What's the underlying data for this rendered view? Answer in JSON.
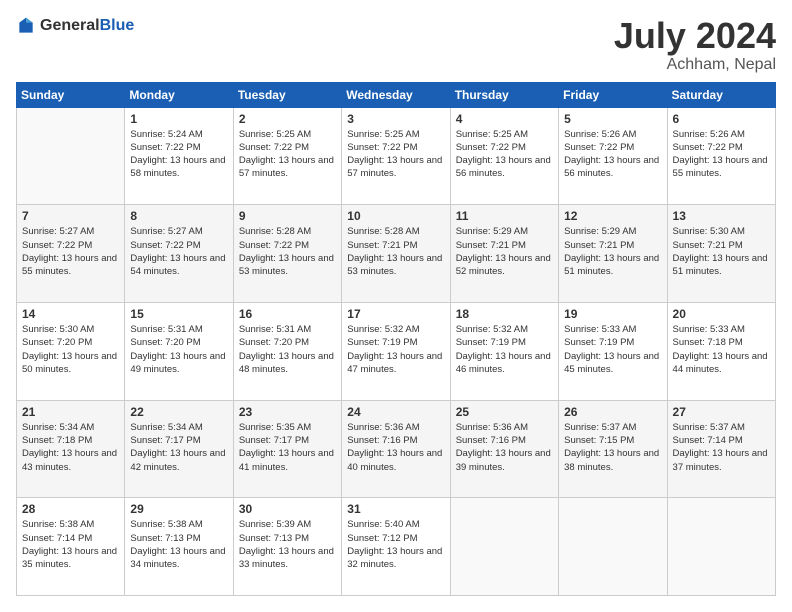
{
  "logo": {
    "general": "General",
    "blue": "Blue"
  },
  "title": {
    "month_year": "July 2024",
    "location": "Achham, Nepal"
  },
  "headers": [
    "Sunday",
    "Monday",
    "Tuesday",
    "Wednesday",
    "Thursday",
    "Friday",
    "Saturday"
  ],
  "weeks": [
    [
      {
        "day": "",
        "sunrise": "",
        "sunset": "",
        "daylight": ""
      },
      {
        "day": "1",
        "sunrise": "Sunrise: 5:24 AM",
        "sunset": "Sunset: 7:22 PM",
        "daylight": "Daylight: 13 hours and 58 minutes."
      },
      {
        "day": "2",
        "sunrise": "Sunrise: 5:25 AM",
        "sunset": "Sunset: 7:22 PM",
        "daylight": "Daylight: 13 hours and 57 minutes."
      },
      {
        "day": "3",
        "sunrise": "Sunrise: 5:25 AM",
        "sunset": "Sunset: 7:22 PM",
        "daylight": "Daylight: 13 hours and 57 minutes."
      },
      {
        "day": "4",
        "sunrise": "Sunrise: 5:25 AM",
        "sunset": "Sunset: 7:22 PM",
        "daylight": "Daylight: 13 hours and 56 minutes."
      },
      {
        "day": "5",
        "sunrise": "Sunrise: 5:26 AM",
        "sunset": "Sunset: 7:22 PM",
        "daylight": "Daylight: 13 hours and 56 minutes."
      },
      {
        "day": "6",
        "sunrise": "Sunrise: 5:26 AM",
        "sunset": "Sunset: 7:22 PM",
        "daylight": "Daylight: 13 hours and 55 minutes."
      }
    ],
    [
      {
        "day": "7",
        "sunrise": "Sunrise: 5:27 AM",
        "sunset": "Sunset: 7:22 PM",
        "daylight": "Daylight: 13 hours and 55 minutes."
      },
      {
        "day": "8",
        "sunrise": "Sunrise: 5:27 AM",
        "sunset": "Sunset: 7:22 PM",
        "daylight": "Daylight: 13 hours and 54 minutes."
      },
      {
        "day": "9",
        "sunrise": "Sunrise: 5:28 AM",
        "sunset": "Sunset: 7:22 PM",
        "daylight": "Daylight: 13 hours and 53 minutes."
      },
      {
        "day": "10",
        "sunrise": "Sunrise: 5:28 AM",
        "sunset": "Sunset: 7:21 PM",
        "daylight": "Daylight: 13 hours and 53 minutes."
      },
      {
        "day": "11",
        "sunrise": "Sunrise: 5:29 AM",
        "sunset": "Sunset: 7:21 PM",
        "daylight": "Daylight: 13 hours and 52 minutes."
      },
      {
        "day": "12",
        "sunrise": "Sunrise: 5:29 AM",
        "sunset": "Sunset: 7:21 PM",
        "daylight": "Daylight: 13 hours and 51 minutes."
      },
      {
        "day": "13",
        "sunrise": "Sunrise: 5:30 AM",
        "sunset": "Sunset: 7:21 PM",
        "daylight": "Daylight: 13 hours and 51 minutes."
      }
    ],
    [
      {
        "day": "14",
        "sunrise": "Sunrise: 5:30 AM",
        "sunset": "Sunset: 7:20 PM",
        "daylight": "Daylight: 13 hours and 50 minutes."
      },
      {
        "day": "15",
        "sunrise": "Sunrise: 5:31 AM",
        "sunset": "Sunset: 7:20 PM",
        "daylight": "Daylight: 13 hours and 49 minutes."
      },
      {
        "day": "16",
        "sunrise": "Sunrise: 5:31 AM",
        "sunset": "Sunset: 7:20 PM",
        "daylight": "Daylight: 13 hours and 48 minutes."
      },
      {
        "day": "17",
        "sunrise": "Sunrise: 5:32 AM",
        "sunset": "Sunset: 7:19 PM",
        "daylight": "Daylight: 13 hours and 47 minutes."
      },
      {
        "day": "18",
        "sunrise": "Sunrise: 5:32 AM",
        "sunset": "Sunset: 7:19 PM",
        "daylight": "Daylight: 13 hours and 46 minutes."
      },
      {
        "day": "19",
        "sunrise": "Sunrise: 5:33 AM",
        "sunset": "Sunset: 7:19 PM",
        "daylight": "Daylight: 13 hours and 45 minutes."
      },
      {
        "day": "20",
        "sunrise": "Sunrise: 5:33 AM",
        "sunset": "Sunset: 7:18 PM",
        "daylight": "Daylight: 13 hours and 44 minutes."
      }
    ],
    [
      {
        "day": "21",
        "sunrise": "Sunrise: 5:34 AM",
        "sunset": "Sunset: 7:18 PM",
        "daylight": "Daylight: 13 hours and 43 minutes."
      },
      {
        "day": "22",
        "sunrise": "Sunrise: 5:34 AM",
        "sunset": "Sunset: 7:17 PM",
        "daylight": "Daylight: 13 hours and 42 minutes."
      },
      {
        "day": "23",
        "sunrise": "Sunrise: 5:35 AM",
        "sunset": "Sunset: 7:17 PM",
        "daylight": "Daylight: 13 hours and 41 minutes."
      },
      {
        "day": "24",
        "sunrise": "Sunrise: 5:36 AM",
        "sunset": "Sunset: 7:16 PM",
        "daylight": "Daylight: 13 hours and 40 minutes."
      },
      {
        "day": "25",
        "sunrise": "Sunrise: 5:36 AM",
        "sunset": "Sunset: 7:16 PM",
        "daylight": "Daylight: 13 hours and 39 minutes."
      },
      {
        "day": "26",
        "sunrise": "Sunrise: 5:37 AM",
        "sunset": "Sunset: 7:15 PM",
        "daylight": "Daylight: 13 hours and 38 minutes."
      },
      {
        "day": "27",
        "sunrise": "Sunrise: 5:37 AM",
        "sunset": "Sunset: 7:14 PM",
        "daylight": "Daylight: 13 hours and 37 minutes."
      }
    ],
    [
      {
        "day": "28",
        "sunrise": "Sunrise: 5:38 AM",
        "sunset": "Sunset: 7:14 PM",
        "daylight": "Daylight: 13 hours and 35 minutes."
      },
      {
        "day": "29",
        "sunrise": "Sunrise: 5:38 AM",
        "sunset": "Sunset: 7:13 PM",
        "daylight": "Daylight: 13 hours and 34 minutes."
      },
      {
        "day": "30",
        "sunrise": "Sunrise: 5:39 AM",
        "sunset": "Sunset: 7:13 PM",
        "daylight": "Daylight: 13 hours and 33 minutes."
      },
      {
        "day": "31",
        "sunrise": "Sunrise: 5:40 AM",
        "sunset": "Sunset: 7:12 PM",
        "daylight": "Daylight: 13 hours and 32 minutes."
      },
      {
        "day": "",
        "sunrise": "",
        "sunset": "",
        "daylight": ""
      },
      {
        "day": "",
        "sunrise": "",
        "sunset": "",
        "daylight": ""
      },
      {
        "day": "",
        "sunrise": "",
        "sunset": "",
        "daylight": ""
      }
    ]
  ]
}
